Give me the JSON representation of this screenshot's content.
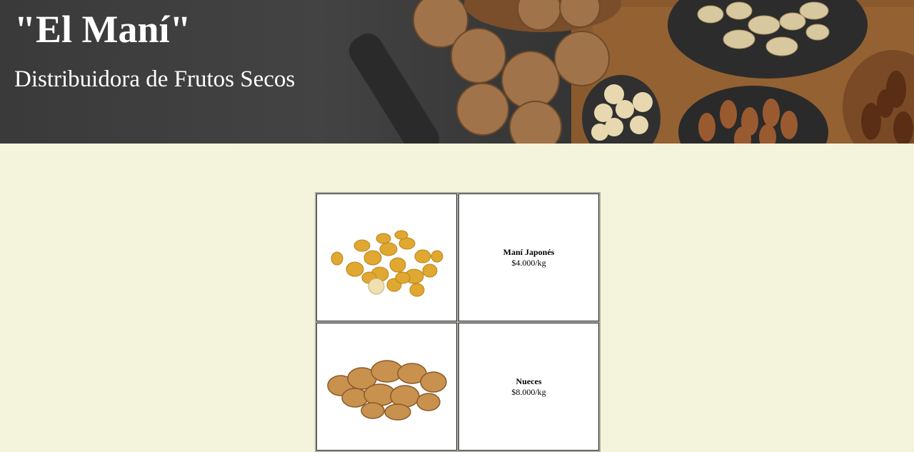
{
  "header": {
    "title": "\"El Maní\"",
    "subtitle": "Distribuidora de Frutos Secos",
    "banner_image": "nuts-assortment-banner"
  },
  "products": [
    {
      "name": "Maní Japonés",
      "price": "$4.000/kg",
      "image": "japanese-peanuts-image"
    },
    {
      "name": "Nueces",
      "price": "$8.000/kg",
      "image": "walnuts-image"
    }
  ],
  "colors": {
    "page_background": "#f4f4dc",
    "banner_background": "#3a3a3a",
    "header_text": "#ffffff"
  }
}
